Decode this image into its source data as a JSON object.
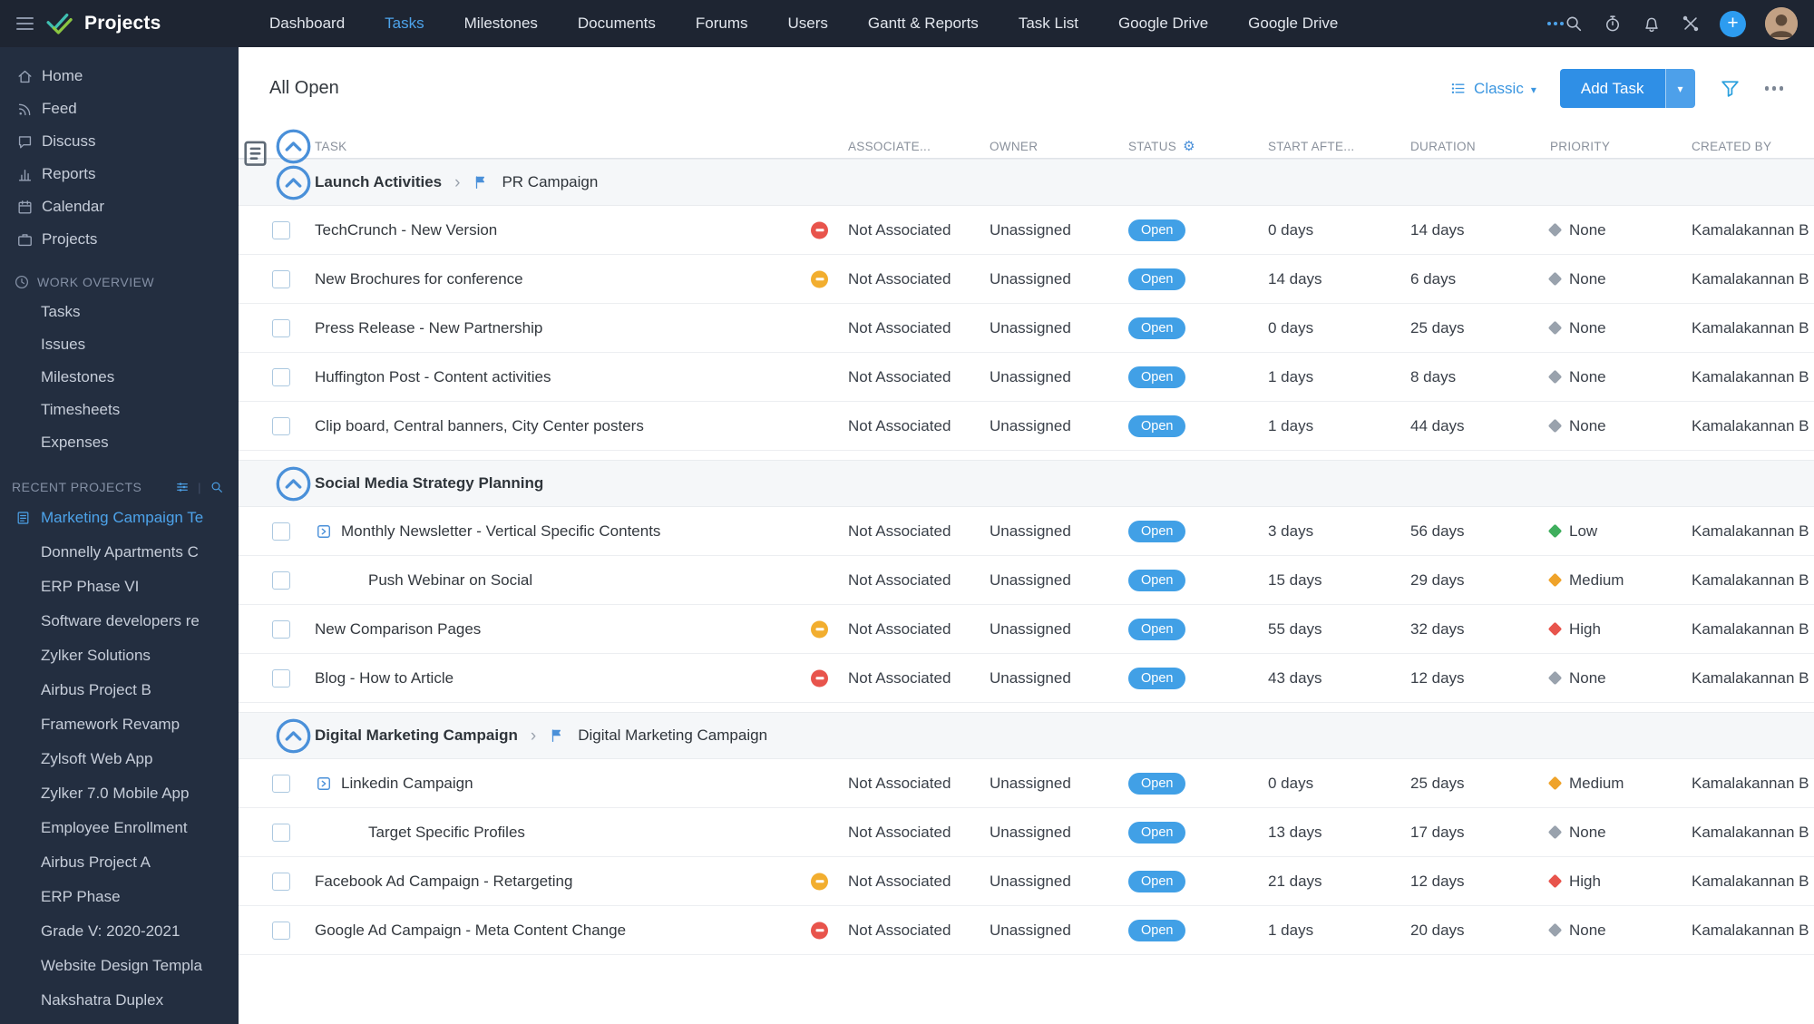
{
  "topbar": {
    "brand": "Projects",
    "nav": [
      {
        "label": "Dashboard"
      },
      {
        "label": "Tasks",
        "active": true
      },
      {
        "label": "Milestones"
      },
      {
        "label": "Documents"
      },
      {
        "label": "Forums"
      },
      {
        "label": "Users"
      },
      {
        "label": "Gantt & Reports"
      },
      {
        "label": "Task List"
      },
      {
        "label": "Google Drive"
      },
      {
        "label": "Google Drive"
      }
    ]
  },
  "sidebar": {
    "items": [
      {
        "icon": "home",
        "label": "Home"
      },
      {
        "icon": "feed",
        "label": "Feed"
      },
      {
        "icon": "discuss",
        "label": "Discuss"
      },
      {
        "icon": "reports",
        "label": "Reports"
      },
      {
        "icon": "calendar",
        "label": "Calendar"
      },
      {
        "icon": "projects",
        "label": "Projects"
      }
    ],
    "work_overview": {
      "title": "WORK OVERVIEW",
      "items": [
        "Tasks",
        "Issues",
        "Milestones",
        "Timesheets",
        "Expenses"
      ]
    },
    "recent_projects": {
      "title": "RECENT PROJECTS",
      "items": [
        {
          "label": "Marketing Campaign Te",
          "active": true,
          "icon": true
        },
        {
          "label": "Donnelly Apartments C"
        },
        {
          "label": "ERP Phase VI"
        },
        {
          "label": "Software developers re"
        },
        {
          "label": "Zylker Solutions"
        },
        {
          "label": "Airbus Project B"
        },
        {
          "label": "Framework Revamp"
        },
        {
          "label": "Zylsoft Web App"
        },
        {
          "label": "Zylker 7.0 Mobile App"
        },
        {
          "label": "Employee Enrollment"
        },
        {
          "label": "Airbus Project A"
        },
        {
          "label": "ERP Phase"
        },
        {
          "label": "Grade V: 2020-2021"
        },
        {
          "label": "Website Design Templa"
        },
        {
          "label": "Nakshatra Duplex"
        }
      ]
    }
  },
  "main": {
    "title": "All Open",
    "view_label": "Classic",
    "add_task_label": "Add Task",
    "columns": [
      "TASK",
      "ASSOCIATE...",
      "OWNER",
      "STATUS",
      "START AFTE...",
      "DURATION",
      "PRIORITY",
      "CREATED BY"
    ],
    "groups": [
      {
        "title": "Launch Activities",
        "milestone": "PR Campaign",
        "rows": [
          {
            "task": "TechCrunch - New Version",
            "alert": "red",
            "associated": "Not Associated",
            "owner": "Unassigned",
            "status": "Open",
            "start_after": "0 days",
            "duration": "14 days",
            "priority": "None",
            "created_by": "Kamalakannan B"
          },
          {
            "task": "New Brochures for conference",
            "alert": "yellow",
            "associated": "Not Associated",
            "owner": "Unassigned",
            "status": "Open",
            "start_after": "14 days",
            "duration": "6 days",
            "priority": "None",
            "created_by": "Kamalakannan B"
          },
          {
            "task": "Press Release - New Partnership",
            "associated": "Not Associated",
            "owner": "Unassigned",
            "status": "Open",
            "start_after": "0 days",
            "duration": "25 days",
            "priority": "None",
            "created_by": "Kamalakannan B"
          },
          {
            "task": "Huffington Post - Content activities",
            "associated": "Not Associated",
            "owner": "Unassigned",
            "status": "Open",
            "start_after": "1 days",
            "duration": "8 days",
            "priority": "None",
            "created_by": "Kamalakannan B"
          },
          {
            "task": "Clip board, Central banners, City Center posters",
            "associated": "Not Associated",
            "owner": "Unassigned",
            "status": "Open",
            "start_after": "1 days",
            "duration": "44 days",
            "priority": "None",
            "created_by": "Kamalakannan B"
          }
        ]
      },
      {
        "title": "Social Media Strategy Planning",
        "milestone": null,
        "rows": [
          {
            "task": "Monthly Newsletter - Vertical Specific Contents",
            "expander": true,
            "associated": "Not Associated",
            "owner": "Unassigned",
            "status": "Open",
            "start_after": "3 days",
            "duration": "56 days",
            "priority": "Low",
            "created_by": "Kamalakannan B"
          },
          {
            "task": "Push Webinar on Social",
            "indent": 1,
            "associated": "Not Associated",
            "owner": "Unassigned",
            "status": "Open",
            "start_after": "15 days",
            "duration": "29 days",
            "priority": "Medium",
            "created_by": "Kamalakannan B"
          },
          {
            "task": "New Comparison Pages",
            "alert": "yellow",
            "associated": "Not Associated",
            "owner": "Unassigned",
            "status": "Open",
            "start_after": "55 days",
            "duration": "32 days",
            "priority": "High",
            "created_by": "Kamalakannan B"
          },
          {
            "task": "Blog - How to Article",
            "alert": "red",
            "associated": "Not Associated",
            "owner": "Unassigned",
            "status": "Open",
            "start_after": "43 days",
            "duration": "12 days",
            "priority": "None",
            "created_by": "Kamalakannan B"
          }
        ]
      },
      {
        "title": "Digital Marketing Campaign",
        "milestone": "Digital Marketing Campaign",
        "rows": [
          {
            "task": "Linkedin Campaign",
            "expander": true,
            "associated": "Not Associated",
            "owner": "Unassigned",
            "status": "Open",
            "start_after": "0 days",
            "duration": "25 days",
            "priority": "Medium",
            "created_by": "Kamalakannan B"
          },
          {
            "task": "Target Specific Profiles",
            "indent": 1,
            "associated": "Not Associated",
            "owner": "Unassigned",
            "status": "Open",
            "start_after": "13 days",
            "duration": "17 days",
            "priority": "None",
            "created_by": "Kamalakannan B"
          },
          {
            "task": "Facebook Ad Campaign - Retargeting",
            "alert": "yellow",
            "associated": "Not Associated",
            "owner": "Unassigned",
            "status": "Open",
            "start_after": "21 days",
            "duration": "12 days",
            "priority": "High",
            "created_by": "Kamalakannan B"
          },
          {
            "task": "Google Ad Campaign - Meta Content Change",
            "alert": "red",
            "associated": "Not Associated",
            "owner": "Unassigned",
            "status": "Open",
            "start_after": "1 days",
            "duration": "20 days",
            "priority": "None",
            "created_by": "Kamalakannan B"
          }
        ]
      }
    ]
  },
  "colors": {
    "accent": "#3b96e0",
    "open_badge": "#41a0e6",
    "alert_red": "#e8544c",
    "alert_yellow": "#f2ae2f",
    "priority_none": "#99a2ad",
    "priority_low": "#3fae5d",
    "priority_medium": "#efa32a",
    "priority_high": "#e8544c"
  }
}
